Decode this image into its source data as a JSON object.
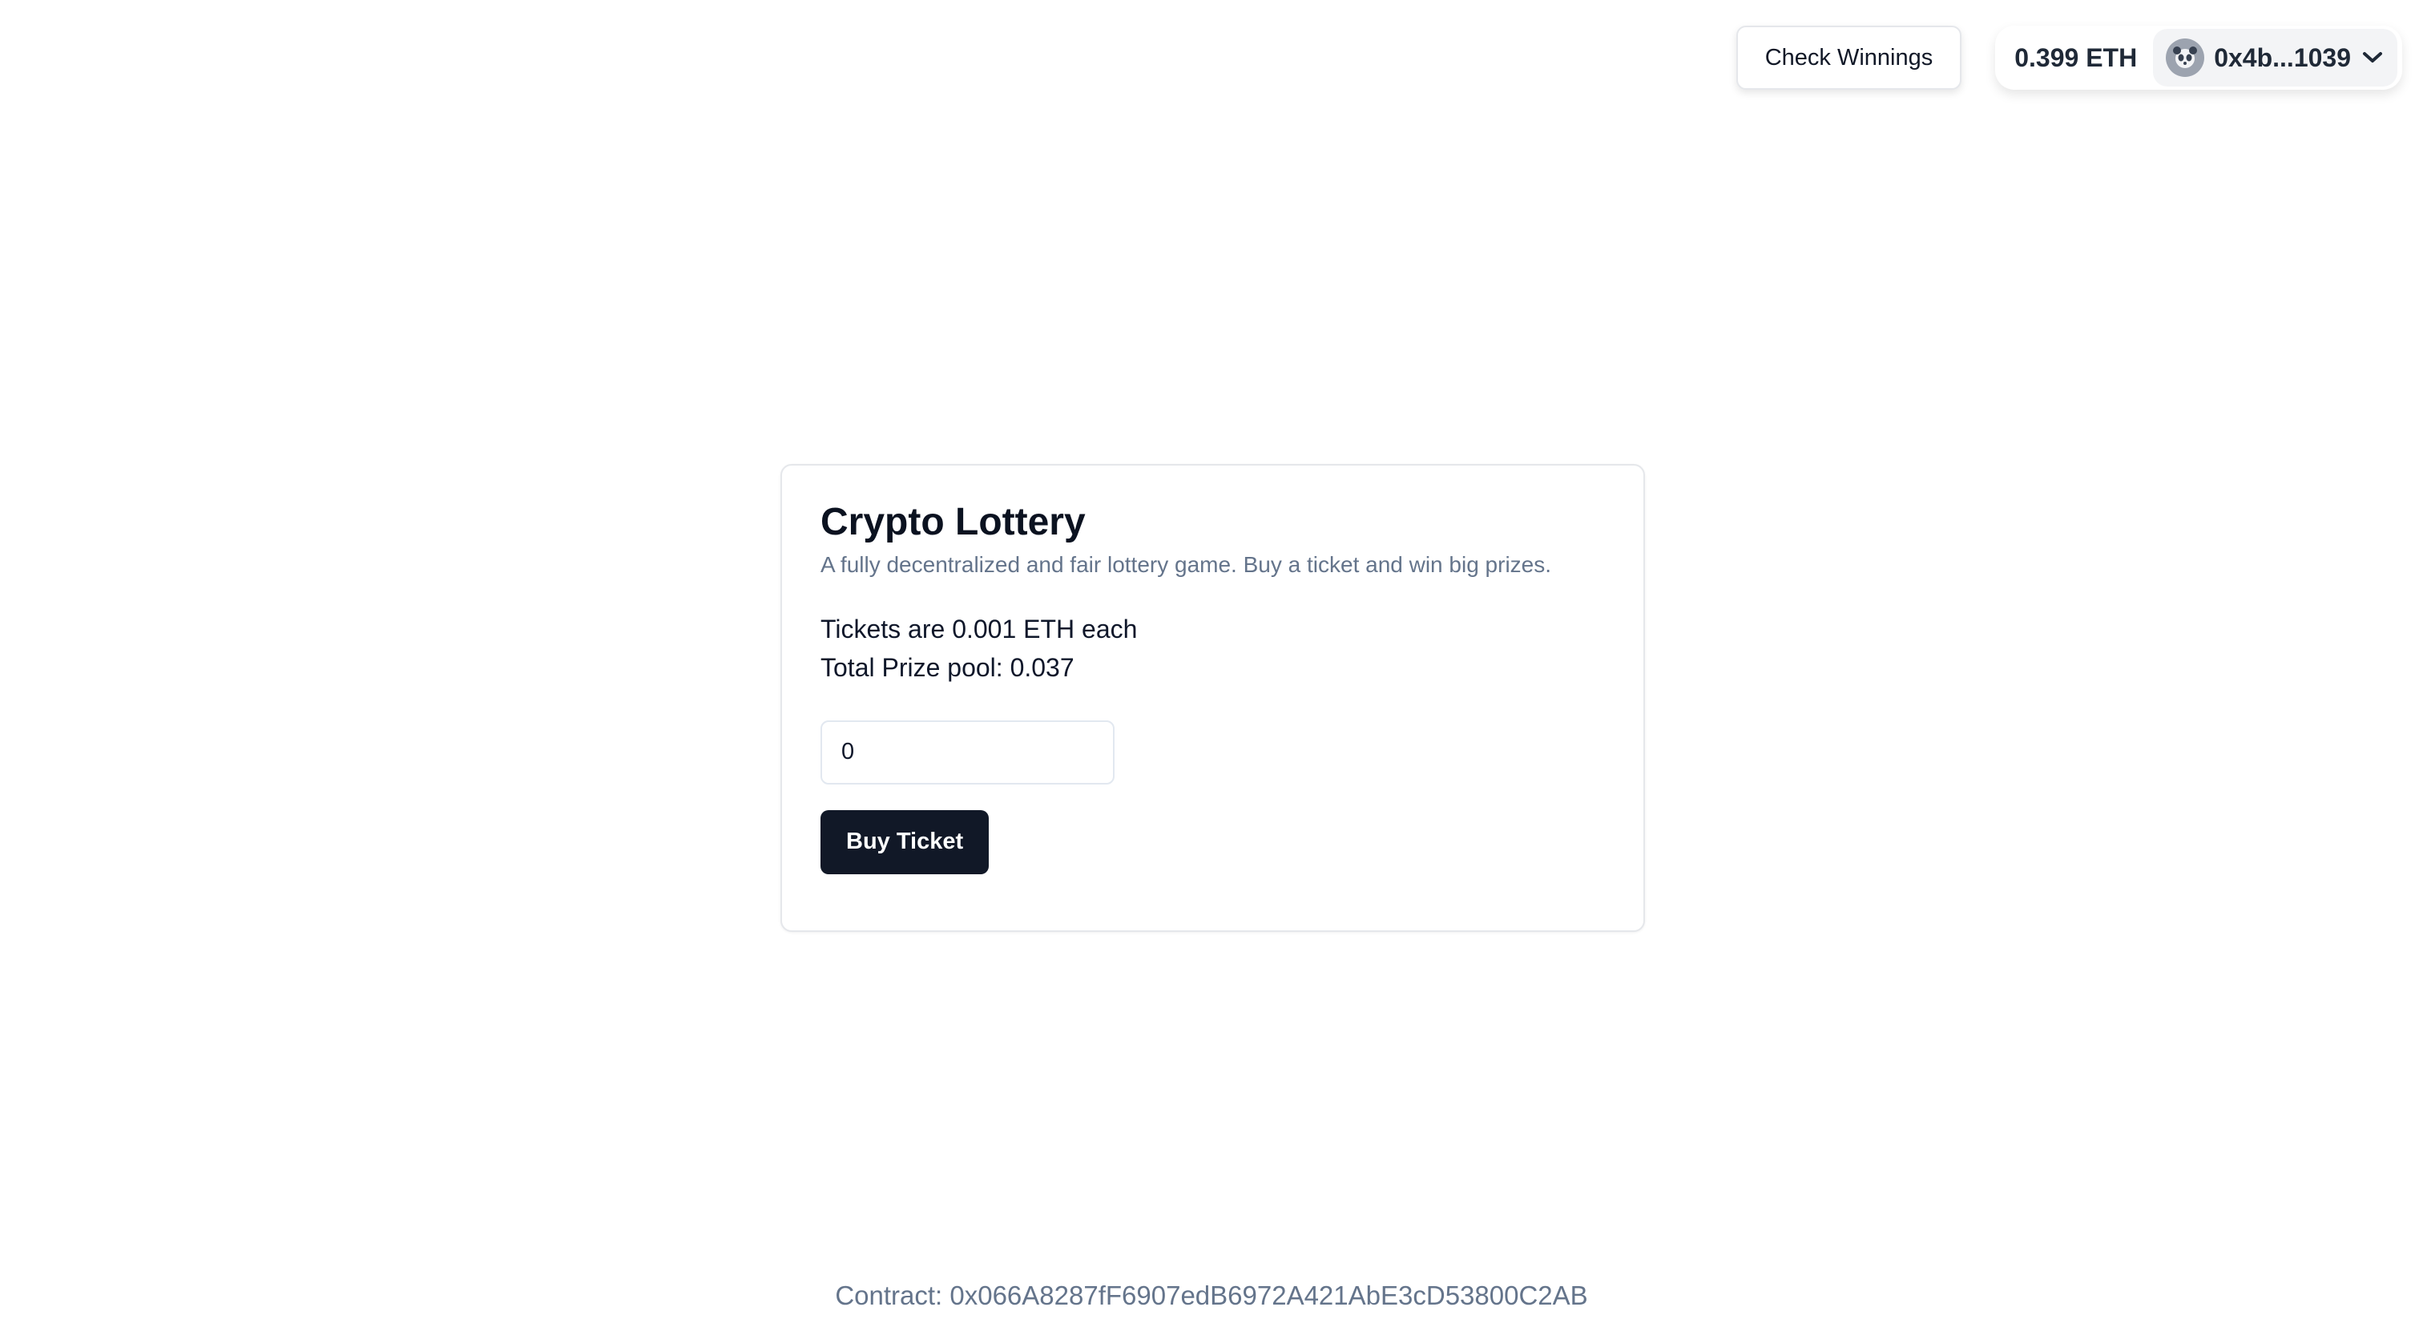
{
  "header": {
    "check_winnings_label": "Check Winnings",
    "wallet": {
      "balance": "0.399 ETH",
      "address": "0x4b...1039",
      "avatar_icon": "panda-avatar-icon",
      "dropdown_icon": "chevron-down-icon"
    }
  },
  "card": {
    "title": "Crypto Lottery",
    "description": "A fully decentralized and fair lottery game. Buy a ticket and win big prizes.",
    "ticket_price_text": "Tickets are 0.001 ETH each",
    "prize_pool_text": "Total Prize pool: 0.037",
    "ticket_input": {
      "value": "0"
    },
    "buy_button_label": "Buy Ticket"
  },
  "footer": {
    "contract_text": "Contract: 0x066A8287fF6907edB6972A421AbE3cD53800C2AB"
  },
  "colors": {
    "primary_button": "#111827",
    "muted_text": "#64748b",
    "border": "#e5e7eb"
  }
}
